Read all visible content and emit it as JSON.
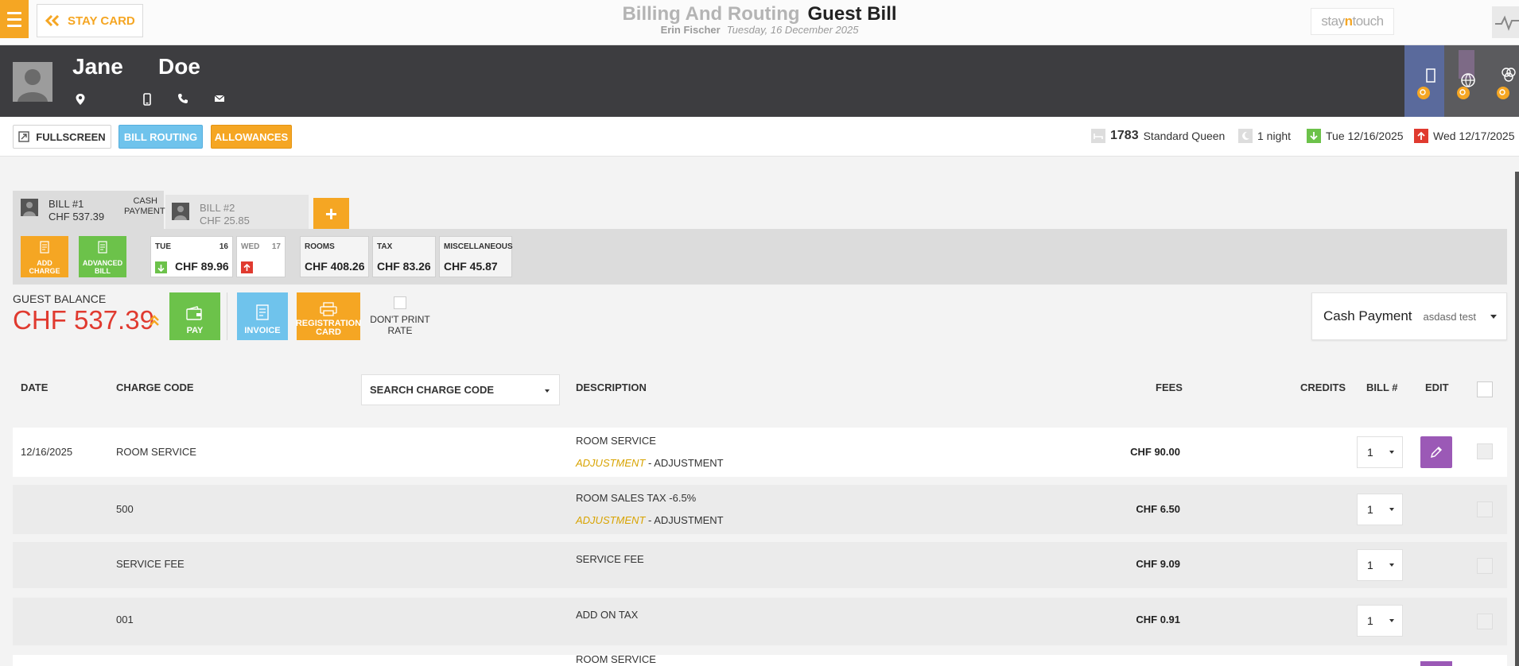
{
  "topbar": {
    "stay_card_label": "STAY CARD",
    "title_light": "Billing And Routing",
    "title_bold": "Guest Bill",
    "user": "Erin Fischer",
    "date": "Tuesday, 16 December 2025",
    "logo_pre": "stay",
    "logo_mid": "n",
    "logo_post": "touch"
  },
  "guest": {
    "first_name": "Jane",
    "last_name": "Doe"
  },
  "toolbar": {
    "fullscreen": "FULLSCREEN",
    "bill_routing": "BILL ROUTING",
    "allowances": "ALLOWANCES",
    "room_number": "1783",
    "room_type": "Standard Queen",
    "nights": "1 night",
    "arrival": "Tue 12/16/2025",
    "departure": "Wed 12/17/2025"
  },
  "bills": [
    {
      "label": "BILL #1",
      "amount": "CHF 537.39",
      "payment_line1": "CASH",
      "payment_line2": "PAYMENT"
    },
    {
      "label": "BILL #2",
      "amount": "CHF 25.85"
    }
  ],
  "add_bill_label": "+",
  "bill_summary": {
    "add_charge_line1": "ADD",
    "add_charge_line2": "CHARGE",
    "advanced_bill_line1": "ADVANCED",
    "advanced_bill_line2": "BILL",
    "days": [
      {
        "name": "TUE",
        "num": "16",
        "amount": "CHF 89.96"
      },
      {
        "name": "WED",
        "num": "17",
        "amount": ""
      }
    ],
    "totals": [
      {
        "label": "ROOMS",
        "value": "CHF 408.26"
      },
      {
        "label": "TAX",
        "value": "CHF 83.26"
      },
      {
        "label": "MISCELLANEOUS",
        "value": "CHF 45.87"
      }
    ]
  },
  "balance": {
    "label": "GUEST BALANCE",
    "value": "CHF 537.39",
    "pay": "PAY",
    "invoice": "INVOICE",
    "reg_line1": "REGISTRATION",
    "reg_line2": "CARD",
    "dont_print_line1": "DON'T PRINT",
    "dont_print_line2": "RATE",
    "payment_method": "Cash Payment",
    "payment_name": "asdasd test"
  },
  "table": {
    "headers": {
      "date": "DATE",
      "charge_code": "CHARGE CODE",
      "search": "SEARCH CHARGE CODE",
      "description": "DESCRIPTION",
      "fees": "FEES",
      "credits": "CREDITS",
      "bill": "BILL #",
      "edit": "EDIT"
    },
    "rows": [
      {
        "date": "12/16/2025",
        "code": "ROOM SERVICE",
        "desc": "ROOM SERVICE",
        "adj1": "ADJUSTMENT",
        "adj2": " - ADJUSTMENT",
        "fee": "CHF 90.00",
        "bill": "1"
      },
      {
        "date": "",
        "code": "500",
        "desc": "ROOM SALES TAX -6.5%",
        "adj1": "ADJUSTMENT",
        "adj2": " - ADJUSTMENT",
        "fee": "CHF 6.50",
        "bill": "1"
      },
      {
        "date": "",
        "code": "SERVICE FEE",
        "desc": "SERVICE FEE",
        "adj1": "",
        "adj2": "",
        "fee": "CHF 9.09",
        "bill": "1"
      },
      {
        "date": "",
        "code": "001",
        "desc": "ADD ON TAX",
        "adj1": "",
        "adj2": "",
        "fee": "CHF 0.91",
        "bill": "1"
      },
      {
        "date": "",
        "code": "",
        "desc": "ROOM SERVICE",
        "adj1": "",
        "adj2": "",
        "fee": "",
        "bill": ""
      }
    ]
  },
  "colors": {
    "accent_orange": "#f5a623",
    "routing_blue": "#6fc3ec",
    "pay_green": "#6cc24a",
    "balance_red": "#e03a2f",
    "edit_purple": "#9b59b6",
    "header_dark": "#3d3d40"
  },
  "icons": [
    "menu-icon",
    "double-chevron-left-icon",
    "pulse-icon",
    "location-pin-icon",
    "mobile-icon",
    "phone-icon",
    "mail-icon",
    "expand-icon",
    "pencil-icon",
    "wallet-icon",
    "printer-icon"
  ]
}
